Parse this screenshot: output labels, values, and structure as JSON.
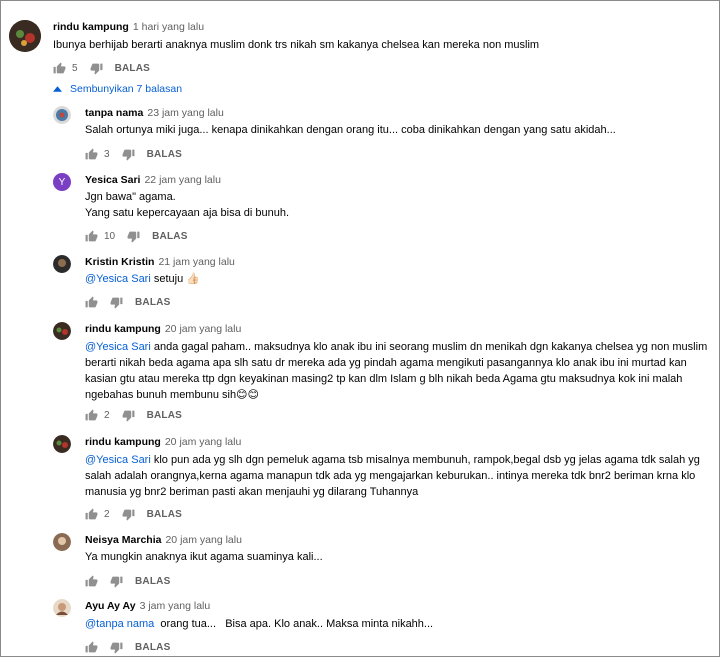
{
  "main_comment": {
    "author": "rindu kampung",
    "time": "1 hari yang lalu",
    "text": "Ibunya berhijab berarti anaknya muslim donk trs nikah sm kakanya chelsea kan mereka non muslim",
    "likes": "5",
    "reply_label": "BALAS",
    "avatar_color": "#3a2b22"
  },
  "replies_toggle": {
    "label": "Sembunyikan 7 balasan",
    "icon": "caret-up-icon",
    "color": "#065fd4"
  },
  "replies": [
    {
      "author": "tanpa nama",
      "time": "23 jam yang lalu",
      "lines": [
        "Salah ortunya miki juga... kenapa dinikahkan dengan orang itu... coba dinikahkan dengan yang satu akidah..."
      ],
      "likes": "3",
      "reply_label": "BALAS",
      "avatar_color": "#4a7aa6"
    },
    {
      "author": "Yesica Sari",
      "time": "22 jam yang lalu",
      "lines": [
        "Jgn bawa\" agama.",
        "Yang satu kepercayaan aja bisa di bunuh."
      ],
      "likes": "10",
      "reply_label": "BALAS",
      "avatar_color": "#7b3fc4",
      "avatar_letter": "Y"
    },
    {
      "author": "Kristin Kristin",
      "time": "21 jam yang lalu",
      "mention": "@Yesica Sari",
      "lines": [
        " setuju 👍🏻"
      ],
      "likes": "",
      "reply_label": "BALAS",
      "avatar_color": "#2b2b2b"
    },
    {
      "author": "rindu kampung",
      "time": "20 jam yang lalu",
      "mention": "@Yesica Sari",
      "lines": [
        " anda gagal paham.. maksudnya klo anak ibu ini seorang muslim dn menikah dgn kakanya chelsea yg non muslim",
        "berarti nikah beda agama apa slh satu dr mereka ada yg pindah agama mengikuti pasangannya klo anak ibu ini murtad kan",
        "kasian gtu atau mereka ttp dgn keyakinan masing2 tp kan dlm Islam g blh nikah beda Agama gtu maksudnya kok ini malah",
        "ngebahas bunuh membunu sih😊😊"
      ],
      "likes": "2",
      "reply_label": "BALAS",
      "avatar_color": "#3a2b22"
    },
    {
      "author": "rindu kampung",
      "time": "20 jam yang lalu",
      "mention": "@Yesica Sari",
      "lines": [
        " klo pun ada yg slh dgn pemeluk agama tsb misalnya membunuh, rampok,begal dsb yg jelas agama tdk salah yg",
        "salah adalah orangnya,kerna agama manapun tdk ada yg mengajarkan keburukan.. intinya mereka tdk bnr2 beriman krna klo",
        "manusia yg bnr2 beriman pasti akan menjauhi yg dilarang Tuhannya"
      ],
      "likes": "2",
      "reply_label": "BALAS",
      "avatar_color": "#3a2b22"
    },
    {
      "author": "Neisya Marchia",
      "time": "20 jam yang lalu",
      "lines": [
        "Ya mungkin anaknya ikut agama suaminya kali..."
      ],
      "likes": "",
      "reply_label": "BALAS",
      "avatar_color": "#8a6a52"
    },
    {
      "author": "Ayu Ay Ay",
      "time": "3 jam yang lalu",
      "mention": "@tanpa nama",
      "lines": [
        "  orang tua...   Bisa apa. Klo anak.. Maksa minta nikahh..."
      ],
      "likes": "",
      "reply_label": "BALAS",
      "avatar_color": "#c89a7a"
    }
  ]
}
